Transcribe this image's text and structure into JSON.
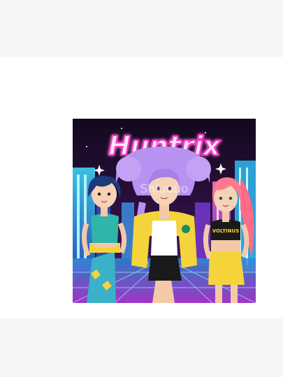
{
  "artwork": {
    "title": "Huntrix",
    "watermark": "Shiuuuo",
    "shirt_text": "VOLTINUS"
  },
  "colors": {
    "page_background": "#ffffff",
    "band_background": "#f6f6f6",
    "title_fill": "#ffe6ff",
    "title_glow": "#ff39c7",
    "sky_dark": "#140b1f",
    "neon_cyan": "#3fe0ff",
    "neon_pink": "#ff4fc8",
    "jacket_yellow": "#f5d33a",
    "hair_lilac": "#b892f0",
    "hair_navy": "#1c3a7a",
    "hair_pink": "#ff7a8e"
  }
}
